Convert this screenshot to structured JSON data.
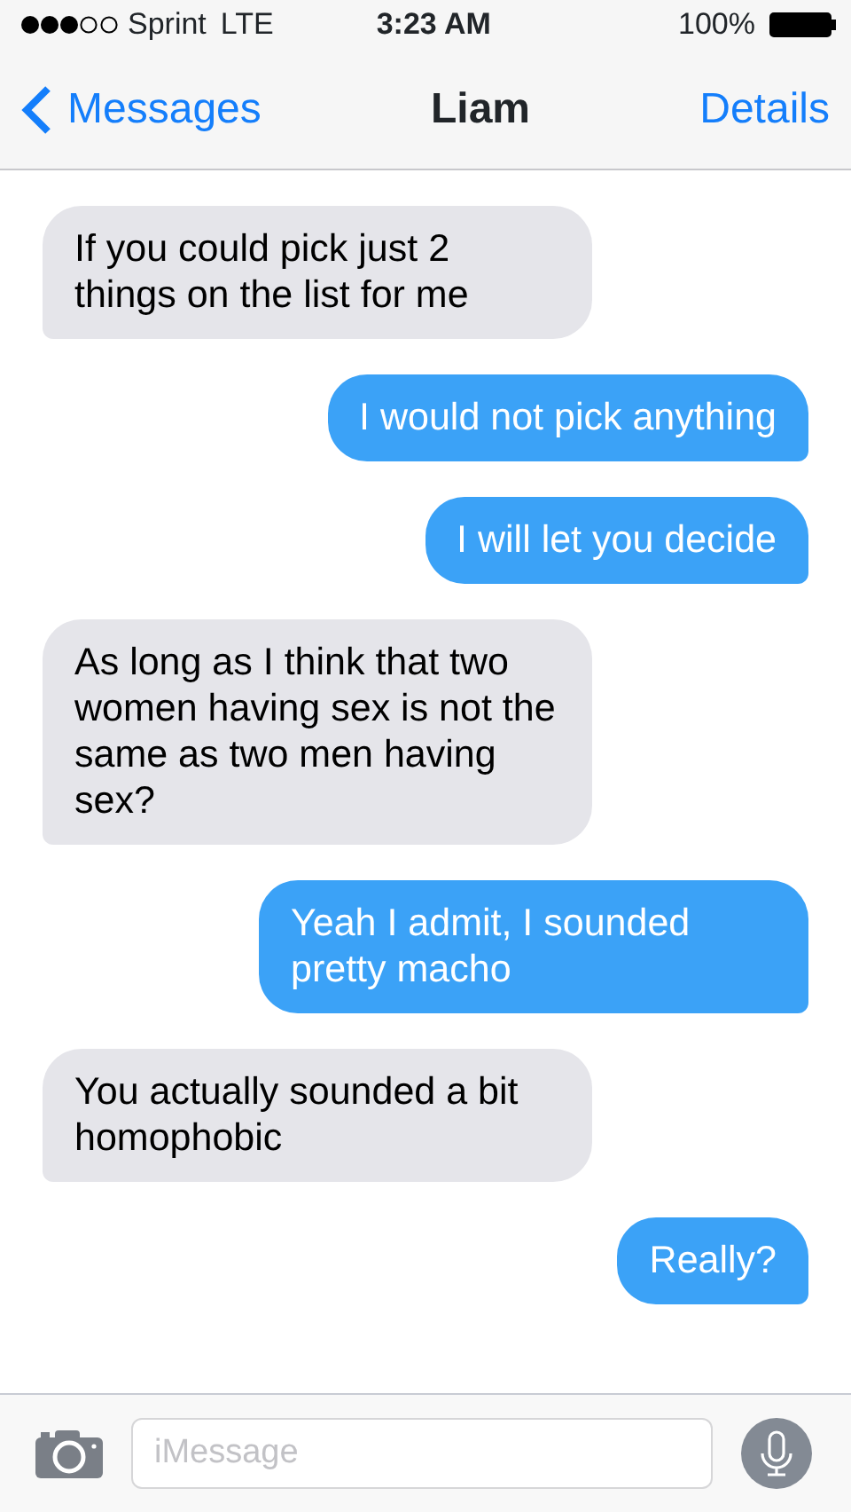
{
  "status_bar": {
    "carrier": "Sprint",
    "network": "LTE",
    "time": "3:23 AM",
    "battery": "100%"
  },
  "nav": {
    "back": "Messages",
    "title": "Liam",
    "action": "Details"
  },
  "messages": [
    {
      "kind": "received",
      "text": "If you could pick just 2 things on the list for me"
    },
    {
      "kind": "sent",
      "text": "I would not pick anything"
    },
    {
      "kind": "sent",
      "text": "I will let you decide"
    },
    {
      "kind": "received",
      "text": "As long as I think that two women having sex is not the same as two men having sex?"
    },
    {
      "kind": "sent",
      "text": "Yeah I admit, I sounded pretty macho"
    },
    {
      "kind": "received",
      "text": "You actually sounded a bit homophobic"
    },
    {
      "kind": "sent",
      "text": "Really?"
    }
  ],
  "composer": {
    "placeholder": "iMessage"
  }
}
